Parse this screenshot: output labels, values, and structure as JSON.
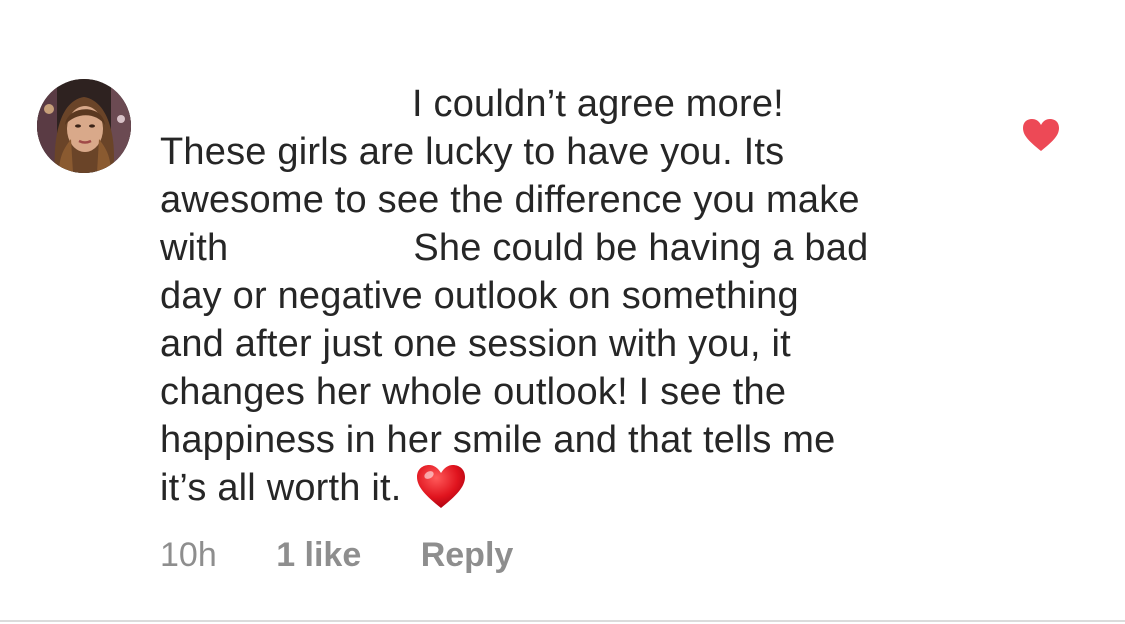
{
  "comment": {
    "text_lines": [
      "I couldn’t agree more!",
      "These girls are lucky to have you. Its",
      "awesome to see the difference you make",
      "with",
      "She could be having a bad",
      "day or negative outlook on something",
      "and after just one session with you, it",
      "changes her whole outlook! I see the",
      "happiness in her smile and that tells me",
      "it’s all worth it."
    ],
    "emoji_icon": "red-heart-emoji",
    "meta": {
      "time": "10h",
      "likes": "1 like",
      "reply": "Reply"
    },
    "like_icon": "heart-icon",
    "like_state": "liked",
    "colors": {
      "text": "#262626",
      "meta": "#8e8e8e",
      "heart": "#ed4956"
    }
  }
}
